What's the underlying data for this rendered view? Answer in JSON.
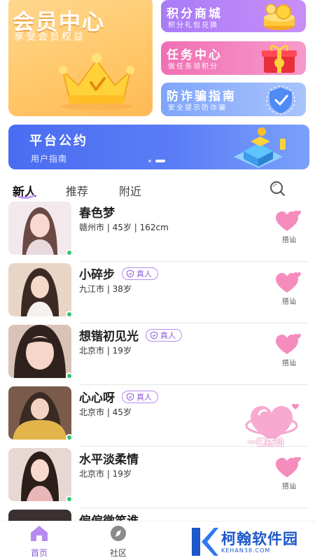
{
  "promo": {
    "member": {
      "title": "会员中心",
      "subtitle": "享受会员权益"
    },
    "points": {
      "title": "积分商城",
      "subtitle": "积分礼包兑换"
    },
    "tasks": {
      "title": "任务中心",
      "subtitle": "做任务领积分"
    },
    "fraud": {
      "title": "防诈骗指南",
      "subtitle": "安全提示防诈骗"
    }
  },
  "banner": {
    "title": "平台公约",
    "subtitle": "用户指南",
    "page_count": 2,
    "active_page": 2
  },
  "tabs": [
    "新人",
    "推荐",
    "附近"
  ],
  "active_tab": 0,
  "icons": {
    "search": "search-icon",
    "heart": "heart-icon",
    "verified": "shield-check-icon",
    "home": "home-icon",
    "community": "compass-icon"
  },
  "colors": {
    "accent": "#8a5ad8",
    "online": "#2fc46a",
    "heart": "#f27fb4"
  },
  "users": [
    {
      "name": "春色梦",
      "meta": "赣州市 | 45岁 | 162cm",
      "verified": false,
      "greet": "搭讪"
    },
    {
      "name": "小碎步",
      "meta": "九江市 | 38岁",
      "verified": true,
      "badge": "真人",
      "greet": "搭讪"
    },
    {
      "name": "想锴初见光",
      "meta": "北京市 | 19岁",
      "verified": true,
      "badge": "真人",
      "greet": "搭讪"
    },
    {
      "name": "心心呀",
      "meta": "北京市 | 45岁",
      "verified": true,
      "badge": "真人",
      "greet": "搭讪"
    },
    {
      "name": "水平淡柔情",
      "meta": "北京市 | 19岁",
      "verified": false,
      "greet": "搭讪"
    },
    {
      "name": "偏偏微笑谁",
      "meta": "",
      "verified": false,
      "greet": ""
    }
  ],
  "float_button": {
    "label": "一键搭讪"
  },
  "nav": [
    {
      "label": "首页",
      "active": true
    },
    {
      "label": "社区",
      "active": false
    }
  ],
  "watermark": {
    "text": "柯翰软件园",
    "url": "KEHAN38.COM"
  }
}
